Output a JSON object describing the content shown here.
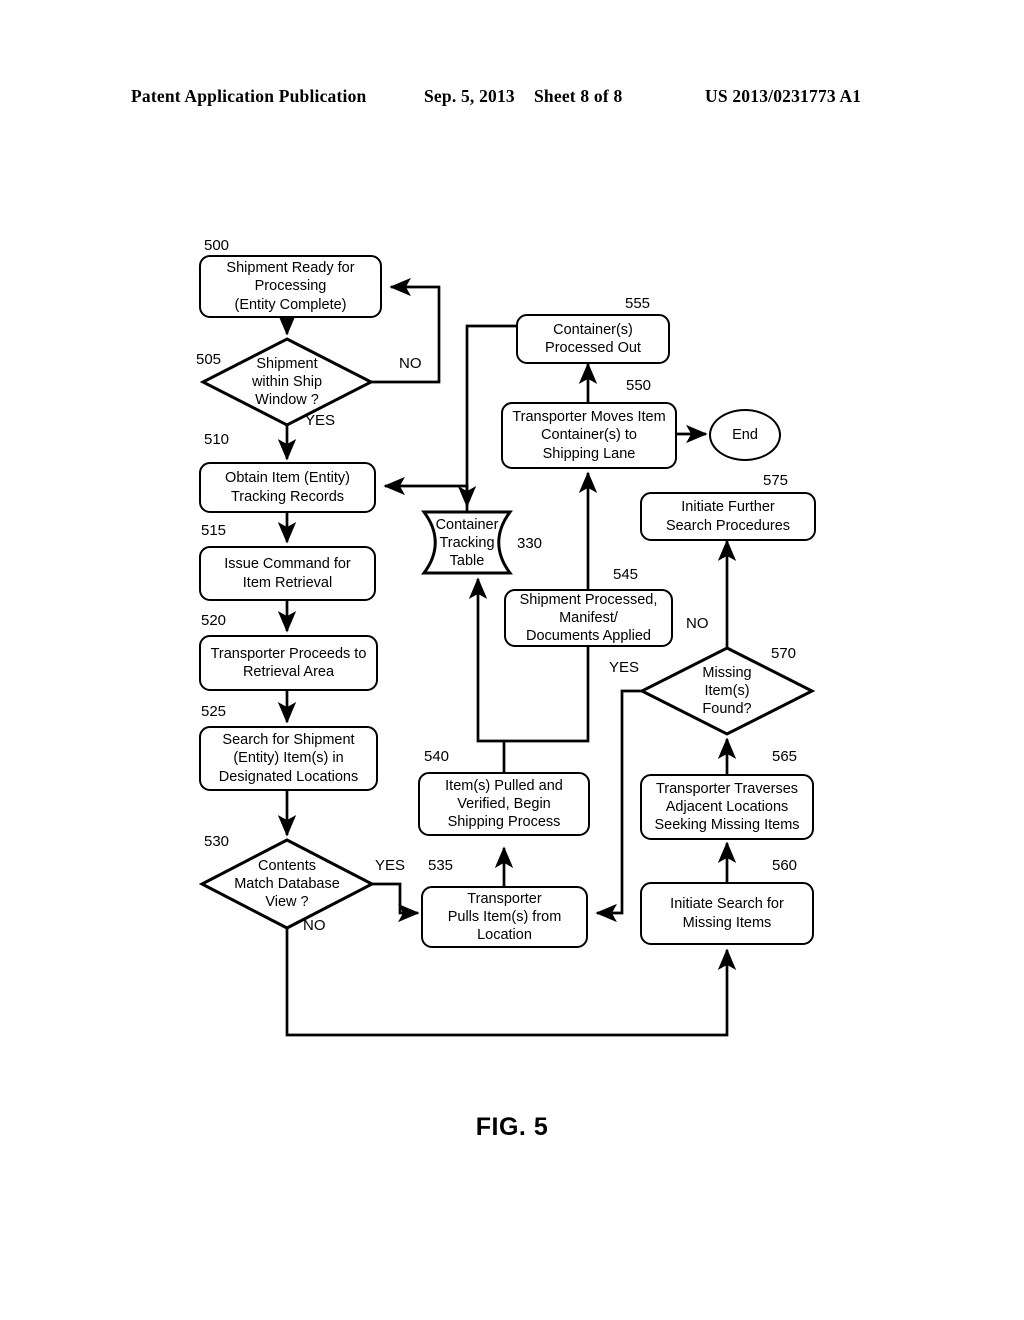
{
  "header": {
    "publication": "Patent Application Publication",
    "date": "Sep. 5, 2013",
    "sheet": "Sheet 8 of 8",
    "patent_number": "US 2013/0231773 A1"
  },
  "figure": {
    "caption": "FIG. 5"
  },
  "nodes": [
    {
      "id": "500",
      "ref": "500",
      "shape": "box",
      "text": "Shipment Ready for Processing (Entity Complete)"
    },
    {
      "id": "505",
      "ref": "505",
      "shape": "diamond",
      "text": "Shipment within Ship Window ?"
    },
    {
      "id": "510",
      "ref": "510",
      "shape": "box",
      "text": "Obtain Item (Entity) Tracking Records"
    },
    {
      "id": "515",
      "ref": "515",
      "shape": "box",
      "text": "Issue Command for Item Retrieval"
    },
    {
      "id": "520",
      "ref": "520",
      "shape": "box",
      "text": "Transporter Proceeds to Retrieval Area"
    },
    {
      "id": "525",
      "ref": "525",
      "shape": "box",
      "text": "Search for Shipment (Entity) Item(s) in Designated Locations"
    },
    {
      "id": "530",
      "ref": "530",
      "shape": "diamond",
      "text": "Contents Match Database View ?"
    },
    {
      "id": "535",
      "ref": "535",
      "shape": "box",
      "text": "Transporter Pulls Item(s) from Location"
    },
    {
      "id": "540",
      "ref": "540",
      "shape": "box",
      "text": "Item(s) Pulled and Verified, Begin Shipping Process"
    },
    {
      "id": "545",
      "ref": "545",
      "shape": "box",
      "text": "Shipment Processed, Manifest/ Documents Applied"
    },
    {
      "id": "550",
      "ref": "550",
      "shape": "box",
      "text": "Transporter Moves Item Container(s) to Shipping Lane"
    },
    {
      "id": "555",
      "ref": "555",
      "shape": "box",
      "text": "Container(s) Processed Out"
    },
    {
      "id": "560",
      "ref": "560",
      "shape": "box",
      "text": "Initiate Search for Missing Items"
    },
    {
      "id": "565",
      "ref": "565",
      "shape": "box",
      "text": "Transporter Traverses Adjacent Locations Seeking Missing Items"
    },
    {
      "id": "570",
      "ref": "570",
      "shape": "diamond",
      "text": "Missing Item(s) Found?"
    },
    {
      "id": "575",
      "ref": "575",
      "shape": "box",
      "text": "Initiate Further Search Procedures"
    },
    {
      "id": "330",
      "ref": "330",
      "shape": "store",
      "text": "Container Tracking Table"
    },
    {
      "id": "end",
      "ref": "",
      "shape": "oval",
      "text": "End"
    }
  ],
  "node_text": {
    "n500": "Shipment Ready for\nProcessing\n(Entity Complete)",
    "n505": "Shipment\nwithin Ship\nWindow ?",
    "n510": "Obtain Item (Entity)\nTracking Records",
    "n515": "Issue Command for\nItem Retrieval",
    "n520": "Transporter Proceeds to\nRetrieval Area",
    "n525": "Search for Shipment\n(Entity) Item(s) in\nDesignated Locations",
    "n530": "Contents\nMatch Database\nView ?",
    "n535": "Transporter\nPulls Item(s) from\nLocation",
    "n540": "Item(s) Pulled and\nVerified, Begin\nShipping Process",
    "n545": "Shipment Processed,\nManifest/\nDocuments Applied",
    "n550": "Transporter Moves Item\nContainer(s) to\nShipping Lane",
    "n555": "Container(s)\nProcessed Out",
    "n560": "Initiate Search for\nMissing Items",
    "n565": "Transporter Traverses\nAdjacent Locations\nSeeking Missing Items",
    "n570": "Missing\nItem(s)\nFound?",
    "n575": "Initiate Further\nSearch Procedures",
    "n330": "Container\nTracking\nTable",
    "nend": "End"
  },
  "refs": {
    "r500": "500",
    "r505": "505",
    "r510": "510",
    "r515": "515",
    "r520": "520",
    "r525": "525",
    "r530": "530",
    "r535": "535",
    "r540": "540",
    "r545": "545",
    "r550": "550",
    "r555": "555",
    "r560": "560",
    "r565": "565",
    "r570": "570",
    "r575": "575",
    "r330": "330"
  },
  "edge_labels": {
    "e505_no": "NO",
    "e505_yes": "YES",
    "e530_yes": "YES",
    "e530_no": "NO",
    "e570_no": "NO",
    "e570_yes": "YES"
  },
  "colors": {
    "ink": "#000000",
    "paper": "#ffffff"
  }
}
